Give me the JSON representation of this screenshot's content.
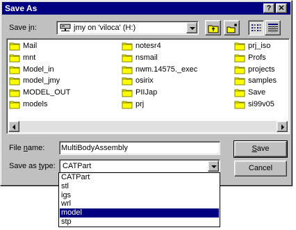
{
  "window": {
    "title": "Save As",
    "help_label": "?",
    "close_label": "✕"
  },
  "save_in": {
    "label_pre": "Save ",
    "label_accel": "i",
    "label_post": "n:",
    "value": "jmy on 'viloca' (H:)"
  },
  "toolbar": {
    "up_folder": "up-one-level-icon",
    "new_folder": "create-new-folder-icon",
    "list_view": "list-view-icon",
    "details_view": "details-view-icon"
  },
  "files": {
    "col1": [
      "Mail",
      "mnt",
      "Model_in",
      "model_jmy",
      "MODEL_OUT",
      "models"
    ],
    "col2": [
      "notesr4",
      "nsmail",
      "nwm.14575._exec",
      "osirix",
      "PIIJap",
      "prj"
    ],
    "col3": [
      "prj_iso",
      "Profs",
      "projects",
      "samples",
      "Save",
      "si99v05"
    ]
  },
  "file_name": {
    "label_pre": "File ",
    "label_accel": "n",
    "label_post": "ame:",
    "value": "MultiBodyAssembly"
  },
  "save_as_type": {
    "label_pre": "Save as ",
    "label_accel": "t",
    "label_post": "ype:",
    "value": "CATPart",
    "options": [
      "CATPart",
      "stl",
      "igs",
      "wrl",
      "model",
      "stp"
    ],
    "selected_index": 4
  },
  "buttons": {
    "save_accel": "S",
    "save_rest": "ave",
    "cancel": "Cancel"
  },
  "colors": {
    "title_bar": "#000080",
    "folder_yellow": "#ffff00",
    "selection": "#000080"
  }
}
